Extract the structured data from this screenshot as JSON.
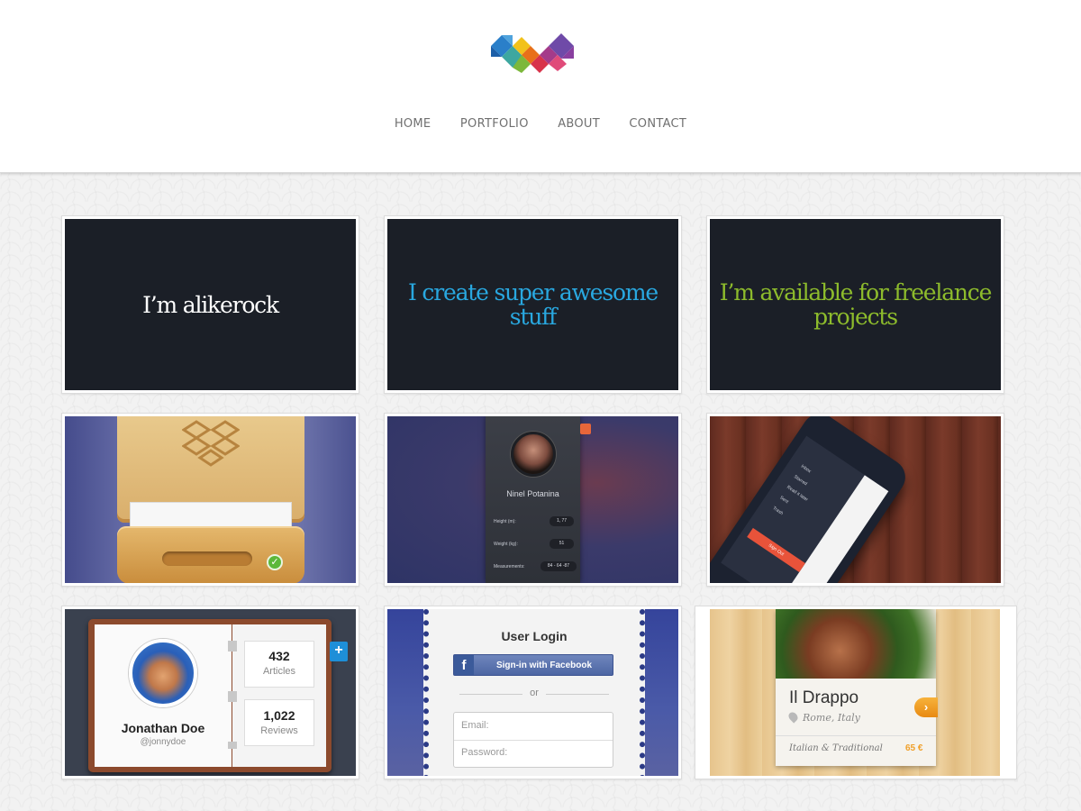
{
  "nav": {
    "items": [
      {
        "label": "HOME"
      },
      {
        "label": "PORTFOLIO"
      },
      {
        "label": "ABOUT"
      },
      {
        "label": "CONTACT"
      }
    ]
  },
  "intro": {
    "tile1": "I’m alikerock",
    "tile2": "I create super awesome stuff",
    "tile3": "I’m available for freelance projects"
  },
  "colors": {
    "white_text": "#ffffff",
    "blue_text": "#29a8e0",
    "green_text": "#8dbb2c",
    "dark_bg": "#1b1f27"
  },
  "profile": {
    "name": "Ninel Potanina",
    "rows": [
      {
        "label": "Height (m):",
        "value": "1, 77"
      },
      {
        "label": "Weight (kg):",
        "value": "51"
      },
      {
        "label": "Measurements:",
        "value": "84 - 64 -87"
      }
    ]
  },
  "phone": {
    "menu": [
      "Inbox",
      "Starred",
      "Read it later",
      "Sent",
      "Trash"
    ],
    "sign_out": "Sign Out"
  },
  "jonathan": {
    "name": "Jonathan Doe",
    "handle": "@jonnydoe",
    "articles_count": "432",
    "articles_label": "Articles",
    "reviews_count": "1,022",
    "reviews_label": "Reviews"
  },
  "login": {
    "title": "User Login",
    "facebook_button": "Sign-in with Facebook",
    "or": "or",
    "email_placeholder": "Email:",
    "password_placeholder": "Password:"
  },
  "restaurant": {
    "name": "Il Drappo",
    "location": "Rome, Italy",
    "category": "Italian & Traditional",
    "price": "65 €"
  }
}
